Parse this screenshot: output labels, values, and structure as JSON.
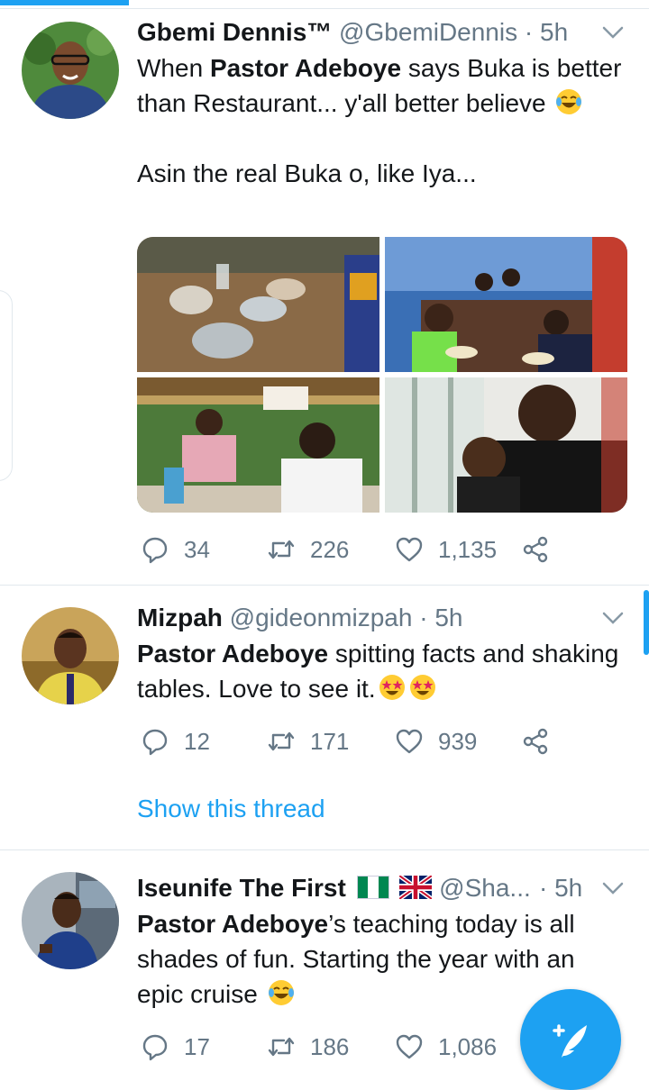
{
  "tweets": [
    {
      "name": "Gbemi Dennis™",
      "handle": "@GbemiDennis",
      "separator": "·",
      "time": "5h",
      "body_line1_pre": "When ",
      "body_bold": "Pastor Adeboye",
      "body_line1_post": " says Buka is better than Restaurant... y'all better believe",
      "body_line2": "Asin the real Buka o, like Iya...",
      "emoji": "tears-of-joy-emoji",
      "media_count": 4,
      "replies": "34",
      "retweets": "226",
      "likes": "1,135"
    },
    {
      "name": "Mizpah",
      "handle": "@gideonmizpah",
      "separator": "·",
      "time": "5h",
      "body_bold": "Pastor Adeboye",
      "body_rest": " spitting facts and shaking tables. Love to see it.",
      "emoji": "star-struck-emoji",
      "replies": "12",
      "retweets": "171",
      "likes": "939",
      "show_thread": "Show this thread"
    },
    {
      "name": "Iseunife The First",
      "handle": "@Sha...",
      "separator": "·",
      "time": "5h",
      "flags": [
        "nigeria-flag-icon",
        "uk-flag-icon"
      ],
      "body_bold": "Pastor Adeboye",
      "body_rest": "’s teaching today is all shades of fun. Starting the year with an epic cruise",
      "emoji": "tears-of-joy-emoji",
      "replies": "17",
      "retweets": "186",
      "likes": "1,086"
    }
  ],
  "icons": {
    "reply": "reply-icon",
    "retweet": "retweet-icon",
    "like": "heart-icon",
    "share": "share-icon",
    "menu": "chevron-down-icon",
    "compose": "compose-tweet-icon"
  },
  "colors": {
    "accent": "#1da1f2",
    "text": "#14171a",
    "muted": "#657786",
    "divider": "#e1e8ed"
  }
}
